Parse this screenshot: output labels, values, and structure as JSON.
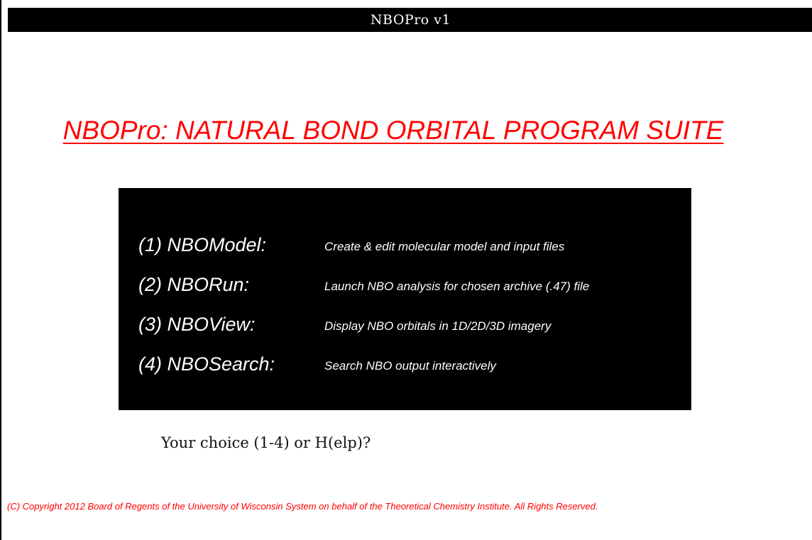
{
  "window": {
    "title": "NBOPro v1"
  },
  "main_title": "NBOPro: NATURAL BOND ORBITAL PROGRAM SUITE",
  "menu": {
    "items": [
      {
        "label": "(1) NBOModel:",
        "description": "Create & edit molecular model and input files"
      },
      {
        "label": "(2) NBORun:",
        "description": "Launch NBO analysis for chosen archive (.47) file"
      },
      {
        "label": "(3) NBOView:",
        "description": "Display NBO orbitals in 1D/2D/3D imagery"
      },
      {
        "label": "(4) NBOSearch:",
        "description": "Search NBO output interactively"
      }
    ]
  },
  "prompt": "Your choice (1-4) or H(elp)?",
  "copyright": "(C) Copyright 2012 Board of Regents of the University of Wisconsin System on behalf of the Theoretical Chemistry Institute. All Rights Reserved.",
  "colors": {
    "title_red": "#ff0000",
    "menu_background": "#000000",
    "menu_text": "#ffffff",
    "titlebar_background": "#000000"
  }
}
